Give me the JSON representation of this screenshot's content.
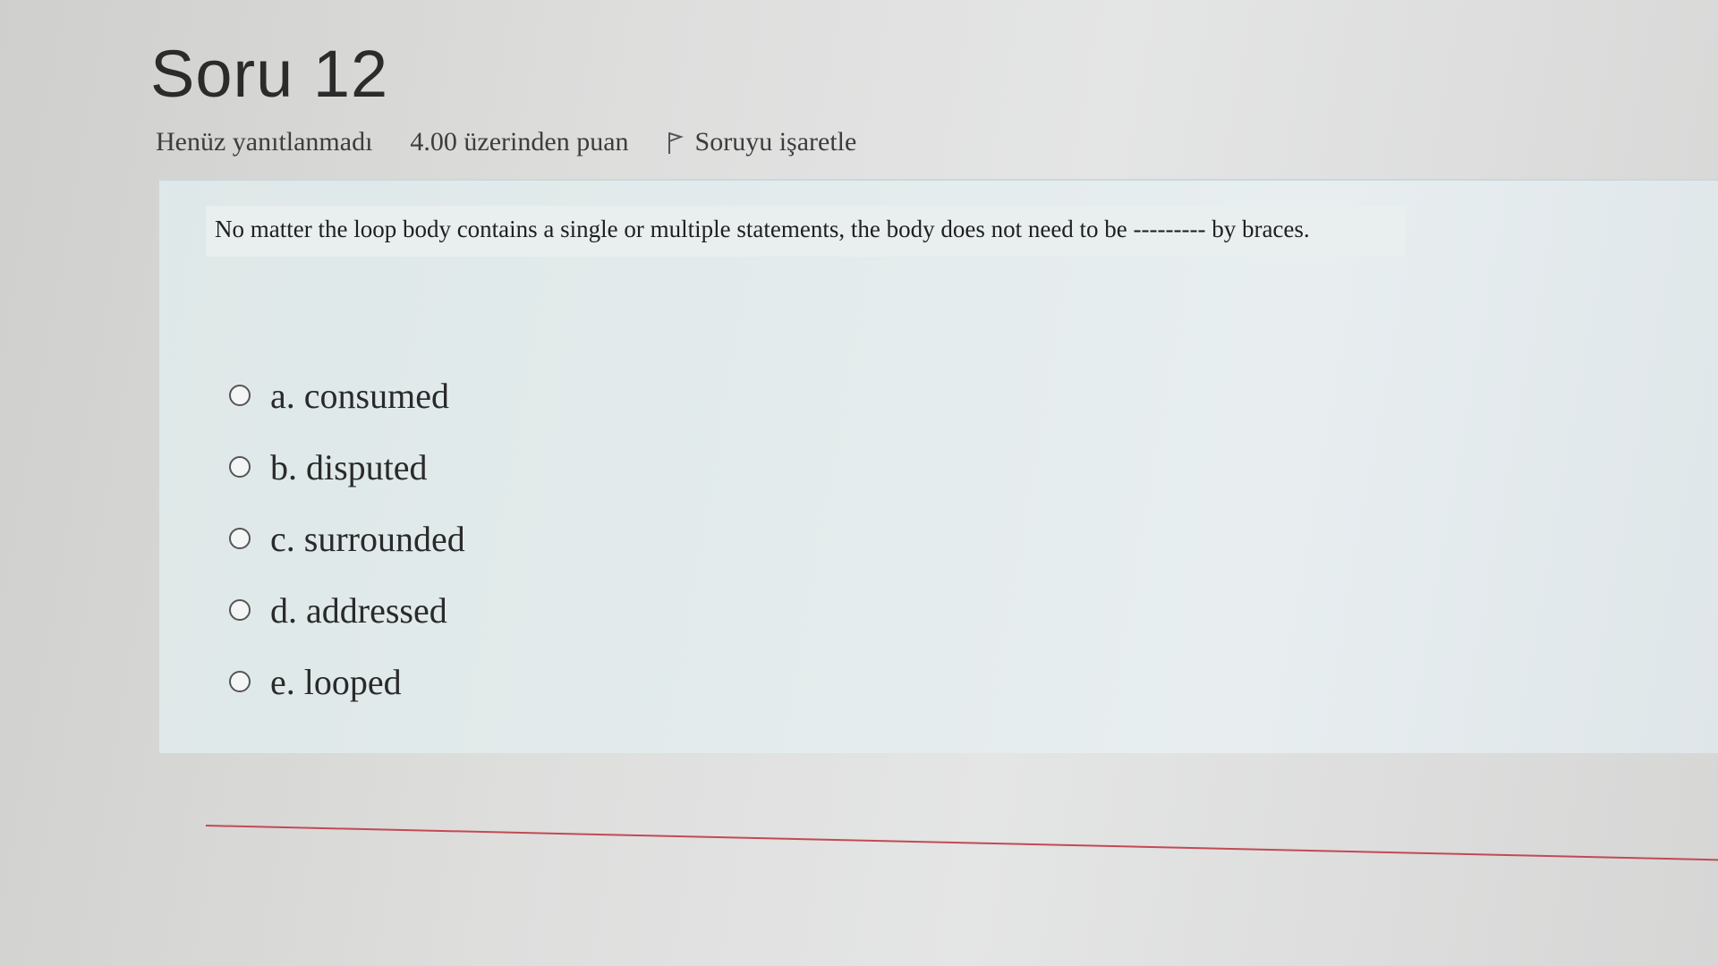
{
  "question": {
    "title": "Soru 12",
    "status": "Henüz yanıtlanmadı",
    "points": "4.00 üzerinden puan",
    "flag_label": "Soruyu işaretle",
    "text": "No matter the loop body contains a single or multiple statements, the body does not need to be --------- by braces."
  },
  "answers": [
    {
      "label": "a. consumed"
    },
    {
      "label": "b. disputed"
    },
    {
      "label": "c. surrounded"
    },
    {
      "label": "d. addressed"
    },
    {
      "label": "e. looped"
    }
  ],
  "icons": {
    "flag": "flag-icon",
    "radio": "radio-button"
  },
  "colors": {
    "card_background": "#e3ebec",
    "divider": "#c24a55",
    "text": "#2a2a2a"
  }
}
